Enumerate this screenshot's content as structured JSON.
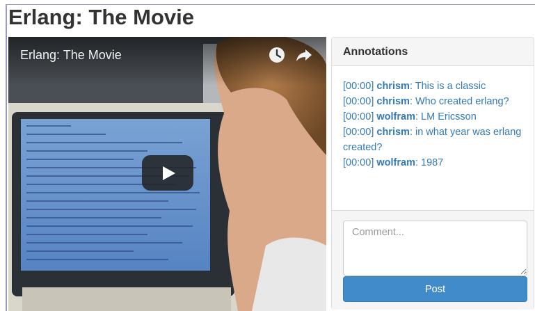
{
  "page": {
    "title": "Erlang: The Movie"
  },
  "video": {
    "title": "Erlang: The Movie",
    "icons": [
      "clock-icon",
      "share-icon",
      "play-icon"
    ]
  },
  "annotations": {
    "heading": "Annotations",
    "items": [
      {
        "time": "[00:00]",
        "user": "chrism",
        "text": ": This is a classic"
      },
      {
        "time": "[00:00]",
        "user": "chrism",
        "text": ": Who created erlang?"
      },
      {
        "time": "[00:00]",
        "user": "wolfram",
        "text": ": LM Ericsson"
      },
      {
        "time": "[00:00]",
        "user": "chrism",
        "text": ": in what year was erlang created?"
      },
      {
        "time": "[00:00]",
        "user": "wolfram",
        "text": ": 1987"
      }
    ]
  },
  "comment": {
    "placeholder": "Comment...",
    "value": ""
  },
  "post_button": {
    "label": "Post"
  },
  "colors": {
    "link": "#337ab7",
    "button": "#428bca",
    "panel_bg": "#f5f5f5"
  }
}
